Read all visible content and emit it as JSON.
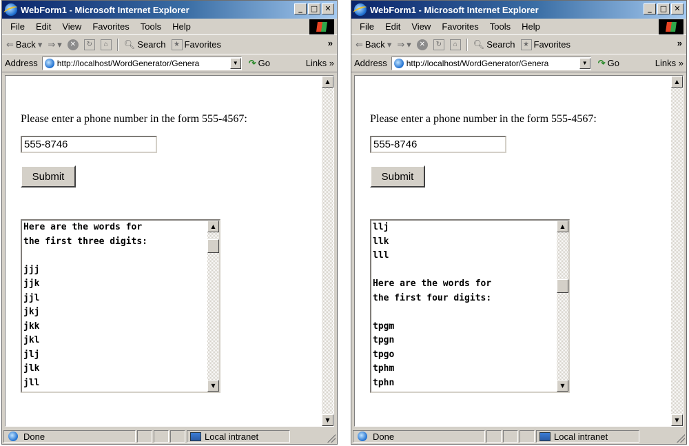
{
  "windows": [
    {
      "title": "WebForm1 - Microsoft Internet Explorer",
      "menu": [
        "File",
        "Edit",
        "View",
        "Favorites",
        "Tools",
        "Help"
      ],
      "toolbar": {
        "back": "Back",
        "search": "Search",
        "favorites": "Favorites"
      },
      "address": {
        "label": "Address",
        "url": "http://localhost/WordGenerator/Genera",
        "go": "Go",
        "links": "Links"
      },
      "content": {
        "prompt": "Please enter a phone number in the form 555-4567:",
        "phone_value": "555-8746",
        "submit_label": "Submit",
        "words_lines": [
          "Here are the words for",
          "the first three digits:",
          "",
          "jjj",
          "jjk",
          "jjl",
          "jkj",
          "jkk",
          "jkl",
          "jlj",
          "jlk",
          "jll"
        ],
        "scroll_position": 0.05
      },
      "status": {
        "text": "Done",
        "zone": "Local intranet"
      }
    },
    {
      "title": "WebForm1 - Microsoft Internet Explorer",
      "menu": [
        "File",
        "Edit",
        "View",
        "Favorites",
        "Tools",
        "Help"
      ],
      "toolbar": {
        "back": "Back",
        "search": "Search",
        "favorites": "Favorites"
      },
      "address": {
        "label": "Address",
        "url": "http://localhost/WordGenerator/Genera",
        "go": "Go",
        "links": "Links"
      },
      "content": {
        "prompt": "Please enter a phone number in the form 555-4567:",
        "phone_value": "555-8746",
        "submit_label": "Submit",
        "words_lines": [
          "llj",
          "llk",
          "lll",
          "",
          "Here are the words for",
          "the first four digits:",
          "",
          "tpgm",
          "tpgn",
          "tpgo",
          "tphm",
          "tphn"
        ],
        "scroll_position": 0.35
      },
      "status": {
        "text": "Done",
        "zone": "Local intranet"
      }
    }
  ]
}
